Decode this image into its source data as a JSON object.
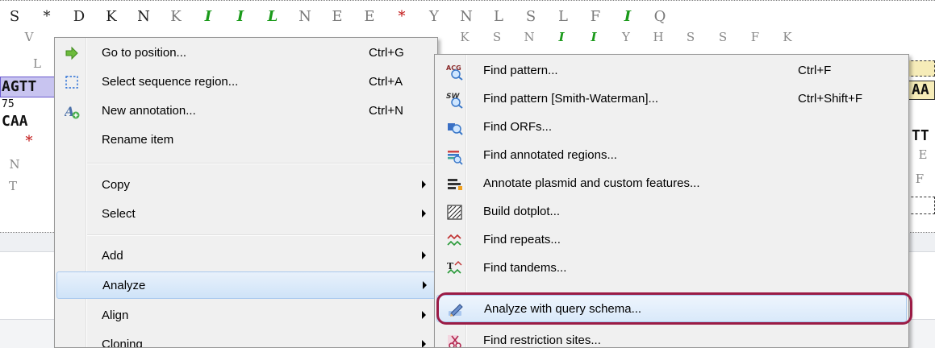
{
  "sequence": {
    "row1": [
      "S",
      "*",
      "D",
      "K",
      "N",
      "K",
      "I",
      "I",
      "L",
      "N",
      "E",
      "E",
      "*",
      "Y",
      "N",
      "L",
      "S",
      "L",
      "F",
      "I",
      "Q"
    ],
    "row2": [
      "V",
      "K",
      "S",
      "N",
      "I",
      "I",
      "Y",
      "H",
      "S",
      "S",
      "F",
      "K"
    ],
    "row3_left": "L",
    "dna_top": "AGTT",
    "dna_top_right": "AA",
    "position_label": "75",
    "dna_bottom": "CAA",
    "dna_bottom_right": "TT",
    "row_stop_left": "*",
    "row_n_left": "N",
    "row_t_left": "T",
    "row_f_right": "F",
    "row_e_right": "E",
    "row_f2_right": "F"
  },
  "context_menu": {
    "items": [
      {
        "label": "Go to position...",
        "shortcut": "Ctrl+G",
        "icon": "green-arrow-icon"
      },
      {
        "label": "Select sequence region...",
        "shortcut": "Ctrl+A",
        "icon": "dashed-select-icon"
      },
      {
        "label": "New annotation...",
        "shortcut": "Ctrl+N",
        "icon": "new-annotation-icon"
      },
      {
        "label": "Rename item",
        "shortcut": "",
        "icon": ""
      },
      {
        "label": "Copy",
        "submenu": true
      },
      {
        "label": "Select",
        "submenu": true
      },
      {
        "label": "Add",
        "submenu": true
      },
      {
        "label": "Analyze",
        "submenu": true,
        "highlighted": true
      },
      {
        "label": "Align",
        "submenu": true
      },
      {
        "label": "Cloning",
        "submenu": true
      }
    ]
  },
  "analyze_submenu": {
    "items": [
      {
        "label": "Find pattern...",
        "shortcut": "Ctrl+F",
        "icon": "find-pattern-icon",
        "icon_text": "ACG"
      },
      {
        "label": "Find pattern [Smith-Waterman]...",
        "shortcut": "Ctrl+Shift+F",
        "icon": "smith-waterman-icon",
        "icon_text": "SW"
      },
      {
        "label": "Find ORFs...",
        "shortcut": "",
        "icon": "find-orfs-icon"
      },
      {
        "label": "Find annotated regions...",
        "shortcut": "",
        "icon": "annotated-regions-icon"
      },
      {
        "label": "Annotate plasmid and custom features...",
        "shortcut": "",
        "icon": "plasmid-features-icon"
      },
      {
        "label": "Build dotplot...",
        "shortcut": "",
        "icon": "dotplot-icon"
      },
      {
        "label": "Find repeats...",
        "shortcut": "",
        "icon": "repeats-icon"
      },
      {
        "label": "Find tandems...",
        "shortcut": "",
        "icon": "tandems-icon"
      },
      {
        "label": "Analyze with query schema...",
        "shortcut": "",
        "icon": "query-schema-icon",
        "highlighted": true
      },
      {
        "label": "Find restriction sites...",
        "shortcut": "",
        "icon": "restriction-sites-icon"
      }
    ]
  },
  "colors": {
    "highlight_ring": "#9b1b45",
    "menu_background": "#f0f0f0",
    "stop_codon": "#c01010",
    "italic_aa": "#1a9a1a"
  }
}
